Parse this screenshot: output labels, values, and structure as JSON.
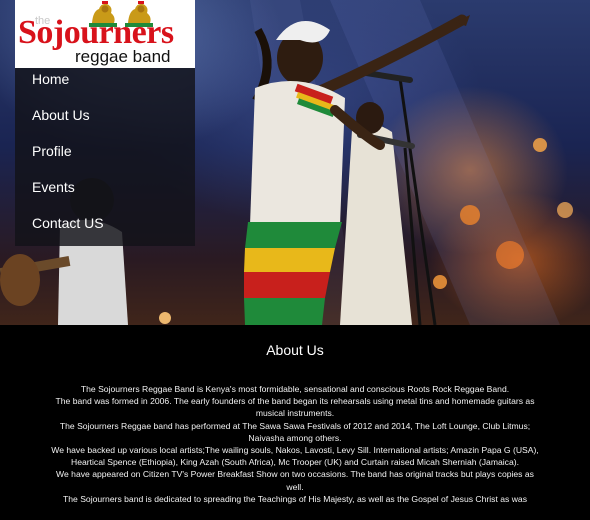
{
  "logo": {
    "the": "the",
    "name": "Sojourners",
    "sub": "reggae band"
  },
  "nav": {
    "items": [
      {
        "label": "Home"
      },
      {
        "label": "About Us"
      },
      {
        "label": "Profile"
      },
      {
        "label": "Events"
      },
      {
        "label": "Contact US"
      }
    ]
  },
  "content": {
    "title": "About Us",
    "paragraphs": [
      "The Sojourners Reggae Band is Kenya's most formidable, sensational and conscious Roots Rock Reggae Band.",
      "The band was formed in 2006. The early founders of the band began its rehearsals using metal tins and homemade guitars as musical instruments.",
      "The Sojourners Reggae band has performed at The Sawa Sawa Festivals of 2012 and 2014, The Loft Lounge, Club Litmus; Naivasha among others.",
      "We have backed up various local artists;The wailing souls, Nakos, Lavosti, Levy Sill. International artists; Amazin Papa G (USA), Heartical Spence (Ethiopia), King Azah (South Africa), Mc Trooper (UK) and Curtain raised Micah Sherniah (Jamaica).",
      "We have appeared on Citizen TV's Power Breakfast Show on two occasions. The band has original tracks but plays copies as well.",
      "The Sojourners band is dedicated to spreading the Teachings of His Majesty, as well as the Gospel of Jesus Christ as was"
    ]
  },
  "colors": {
    "logo_red": "#d8121b",
    "rasta_red": "#c8201c",
    "rasta_gold": "#e8b81a",
    "rasta_green": "#1f8a3a"
  },
  "icons": {
    "lion": "lion-of-judah-icon"
  }
}
